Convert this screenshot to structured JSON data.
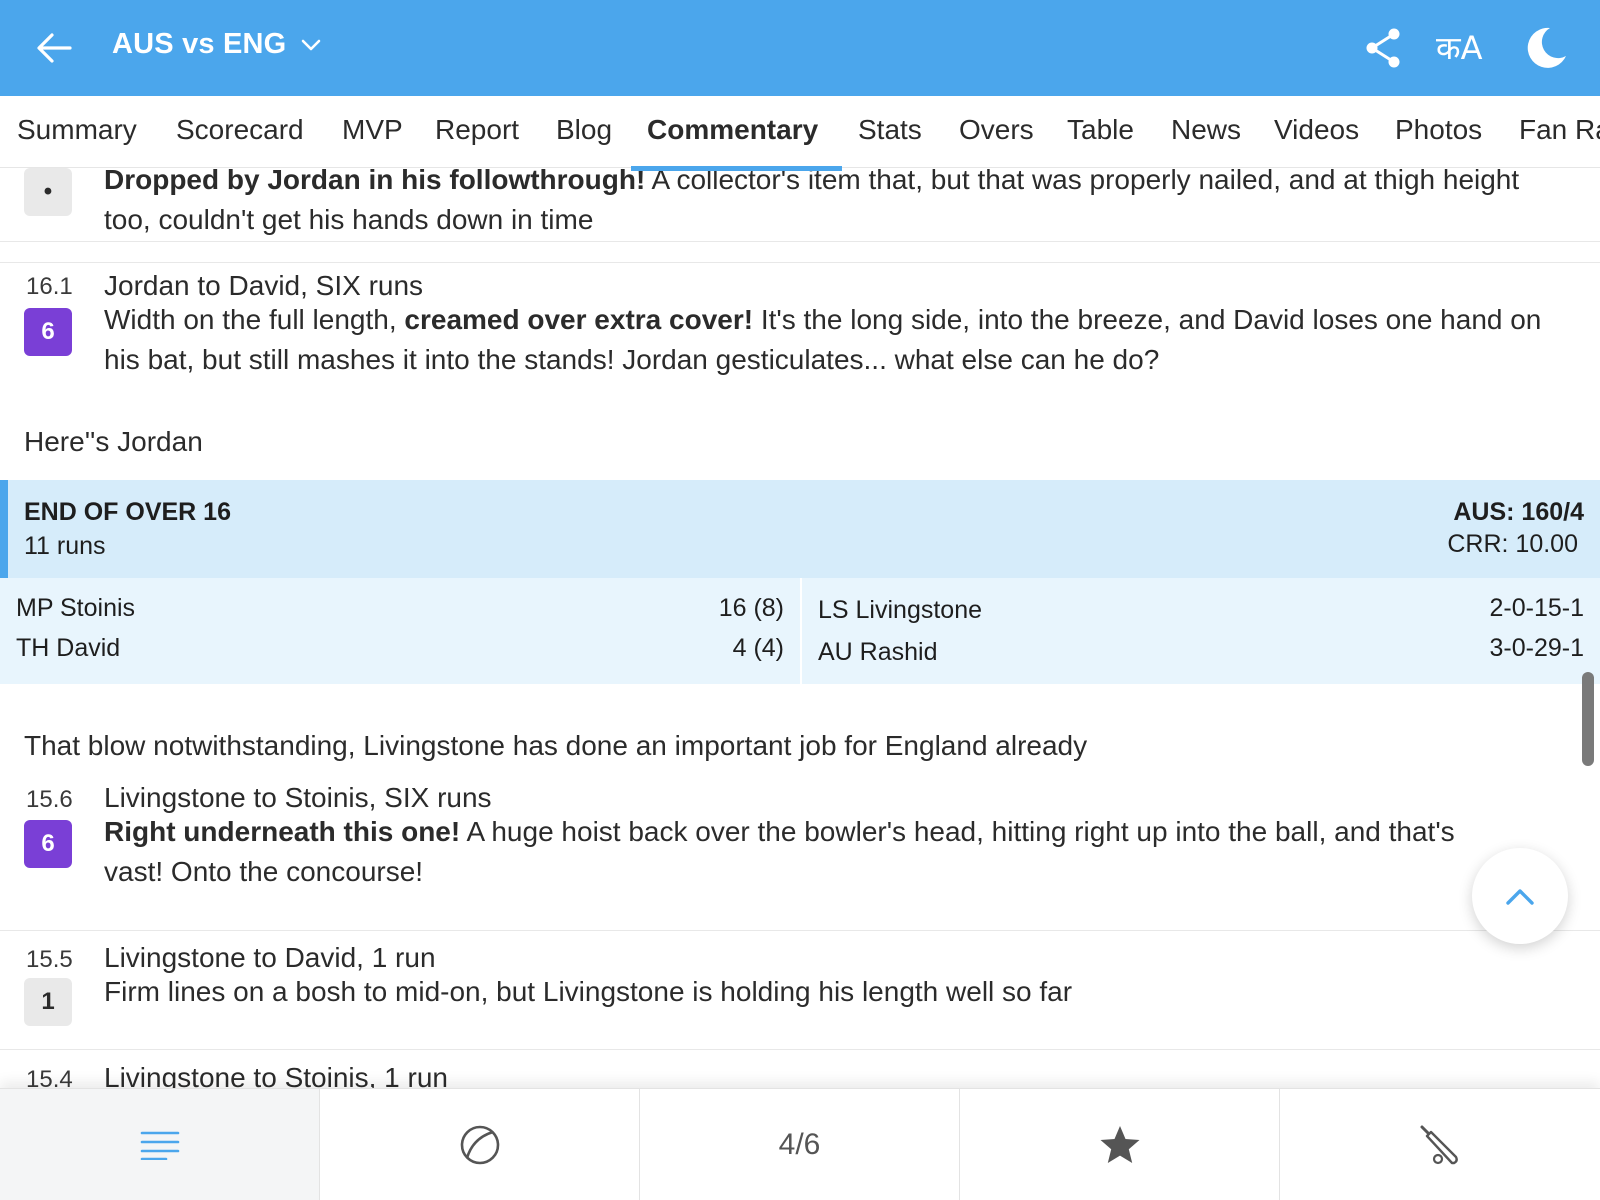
{
  "header": {
    "title": "AUS vs ENG",
    "lang_label": "कA"
  },
  "tabs": [
    "Summary",
    "Scorecard",
    "MVP",
    "Report",
    "Blog",
    "Commentary",
    "Stats",
    "Overs",
    "Table",
    "News",
    "Videos",
    "Photos",
    "Fan Ra"
  ],
  "active_tab": "Commentary",
  "commentary": {
    "partial_top": {
      "badge": "•",
      "bold": "Dropped by Jordan in his followthrough!",
      "text": " A collector's item that, but that was properly nailed, and at thigh height too, couldn't get his hands down in time"
    },
    "ball_16_1": {
      "over": "16.1",
      "badge": "6",
      "headline": "Jordan to David, SIX runs",
      "pre": "Width on the full length, ",
      "bold": "creamed over extra cover!",
      "post": " It's the long side, into the breeze, and David loses one hand on his bat, but still mashes it into the stands! Jordan gesticulates... what else can he do?"
    },
    "note_1": "Here''s Jordan",
    "end_of_over": {
      "title": "END OF OVER 16",
      "runs": "11 runs",
      "score": "AUS: 160/4",
      "crr": "CRR: 10.00",
      "batters": [
        {
          "name": "MP Stoinis",
          "score": "16 (8)"
        },
        {
          "name": "TH David",
          "score": "4 (4)"
        }
      ],
      "bowlers": [
        {
          "name": "LS Livingstone",
          "figures": "2-0-15-1"
        },
        {
          "name": "AU Rashid",
          "figures": "3-0-29-1"
        }
      ]
    },
    "note_2": "That blow notwithstanding, Livingstone has done an important job for England already",
    "ball_15_6": {
      "over": "15.6",
      "badge": "6",
      "headline": "Livingstone to Stoinis, SIX runs",
      "bold": "Right underneath this one!",
      "post": " A huge hoist back over the bowler's head, hitting right up into the ball, and that's vast! Onto the concourse!"
    },
    "ball_15_5": {
      "over": "15.5",
      "badge": "1",
      "headline": "Livingstone to David, 1 run",
      "text": "Firm lines on a bosh to mid-on, but Livingstone is holding his length well so far"
    },
    "ball_15_4": {
      "over": "15.4",
      "headline": "Livingstone to Stoinis, 1 run"
    }
  },
  "bottom_bar": {
    "page_indicator": "4/6",
    "icons": [
      "menu-icon",
      "ball-icon",
      "page-indicator",
      "star-icon",
      "bat-icon"
    ]
  },
  "colors": {
    "header_blue": "#4ba6ec",
    "six_badge": "#7a3fd6",
    "over_head_bg": "#d6ecfa",
    "over_body_bg": "#e8f5fd"
  }
}
